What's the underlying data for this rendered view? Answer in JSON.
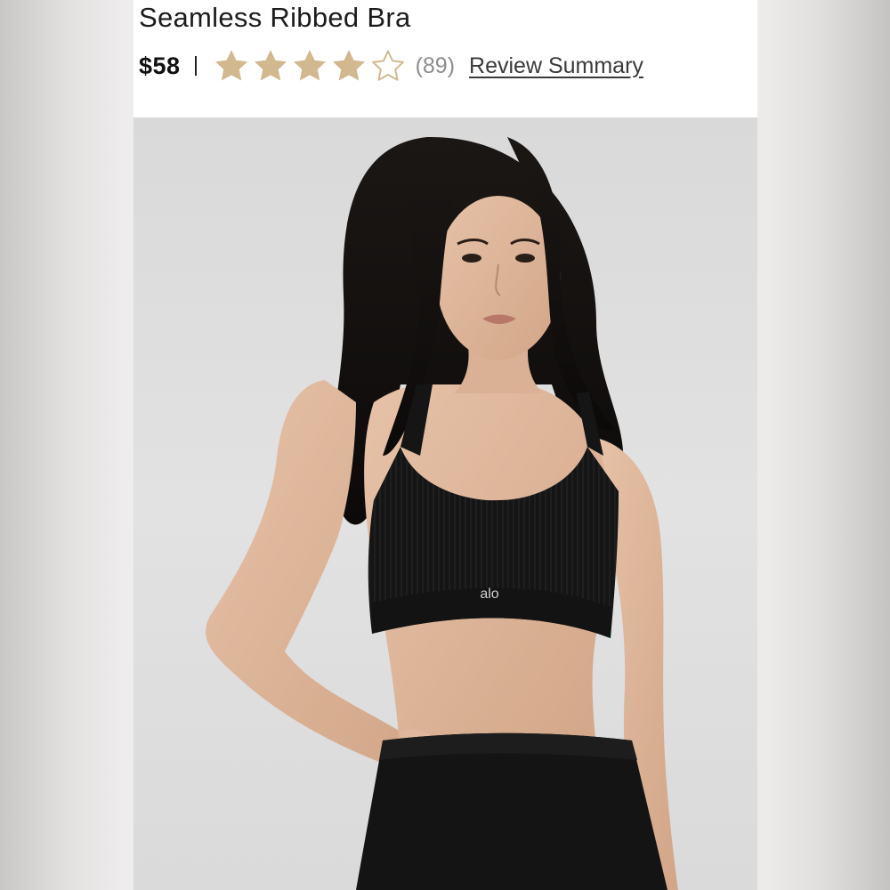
{
  "product": {
    "title": "Seamless Ribbed Bra",
    "price": "$58",
    "price_separator": "|",
    "rating": {
      "value": 4,
      "max": 5,
      "count_label": "(89)",
      "star_color": "#d1b88e"
    },
    "review_link_label": "Review Summary"
  },
  "image": {
    "description_icon": "product-photo",
    "logo_text": "alo"
  }
}
